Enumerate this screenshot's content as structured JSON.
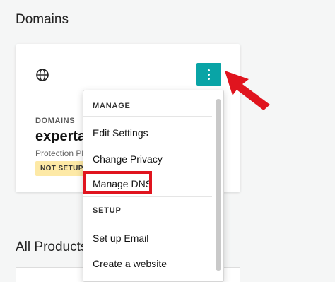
{
  "header": {
    "title": "Domains"
  },
  "card": {
    "globe_icon": "globe-icon",
    "menu_icon": "more-vertical-icon",
    "label": "DOMAINS",
    "domain_name": "expertas",
    "protection": "Protection Pla",
    "badge": "NOT SETUP"
  },
  "section2": {
    "title": "All Products"
  },
  "menu": {
    "manage_header": "MANAGE",
    "items": [
      "Edit Settings",
      "Change Privacy",
      "Manage DNS"
    ],
    "setup_header": "SETUP",
    "setup_items": [
      "Set up Email",
      "Create a website"
    ]
  },
  "colors": {
    "accent": "#09a4a6",
    "highlight": "#e0141e",
    "badge": "#fde9a6",
    "background": "#f5f6f6"
  }
}
